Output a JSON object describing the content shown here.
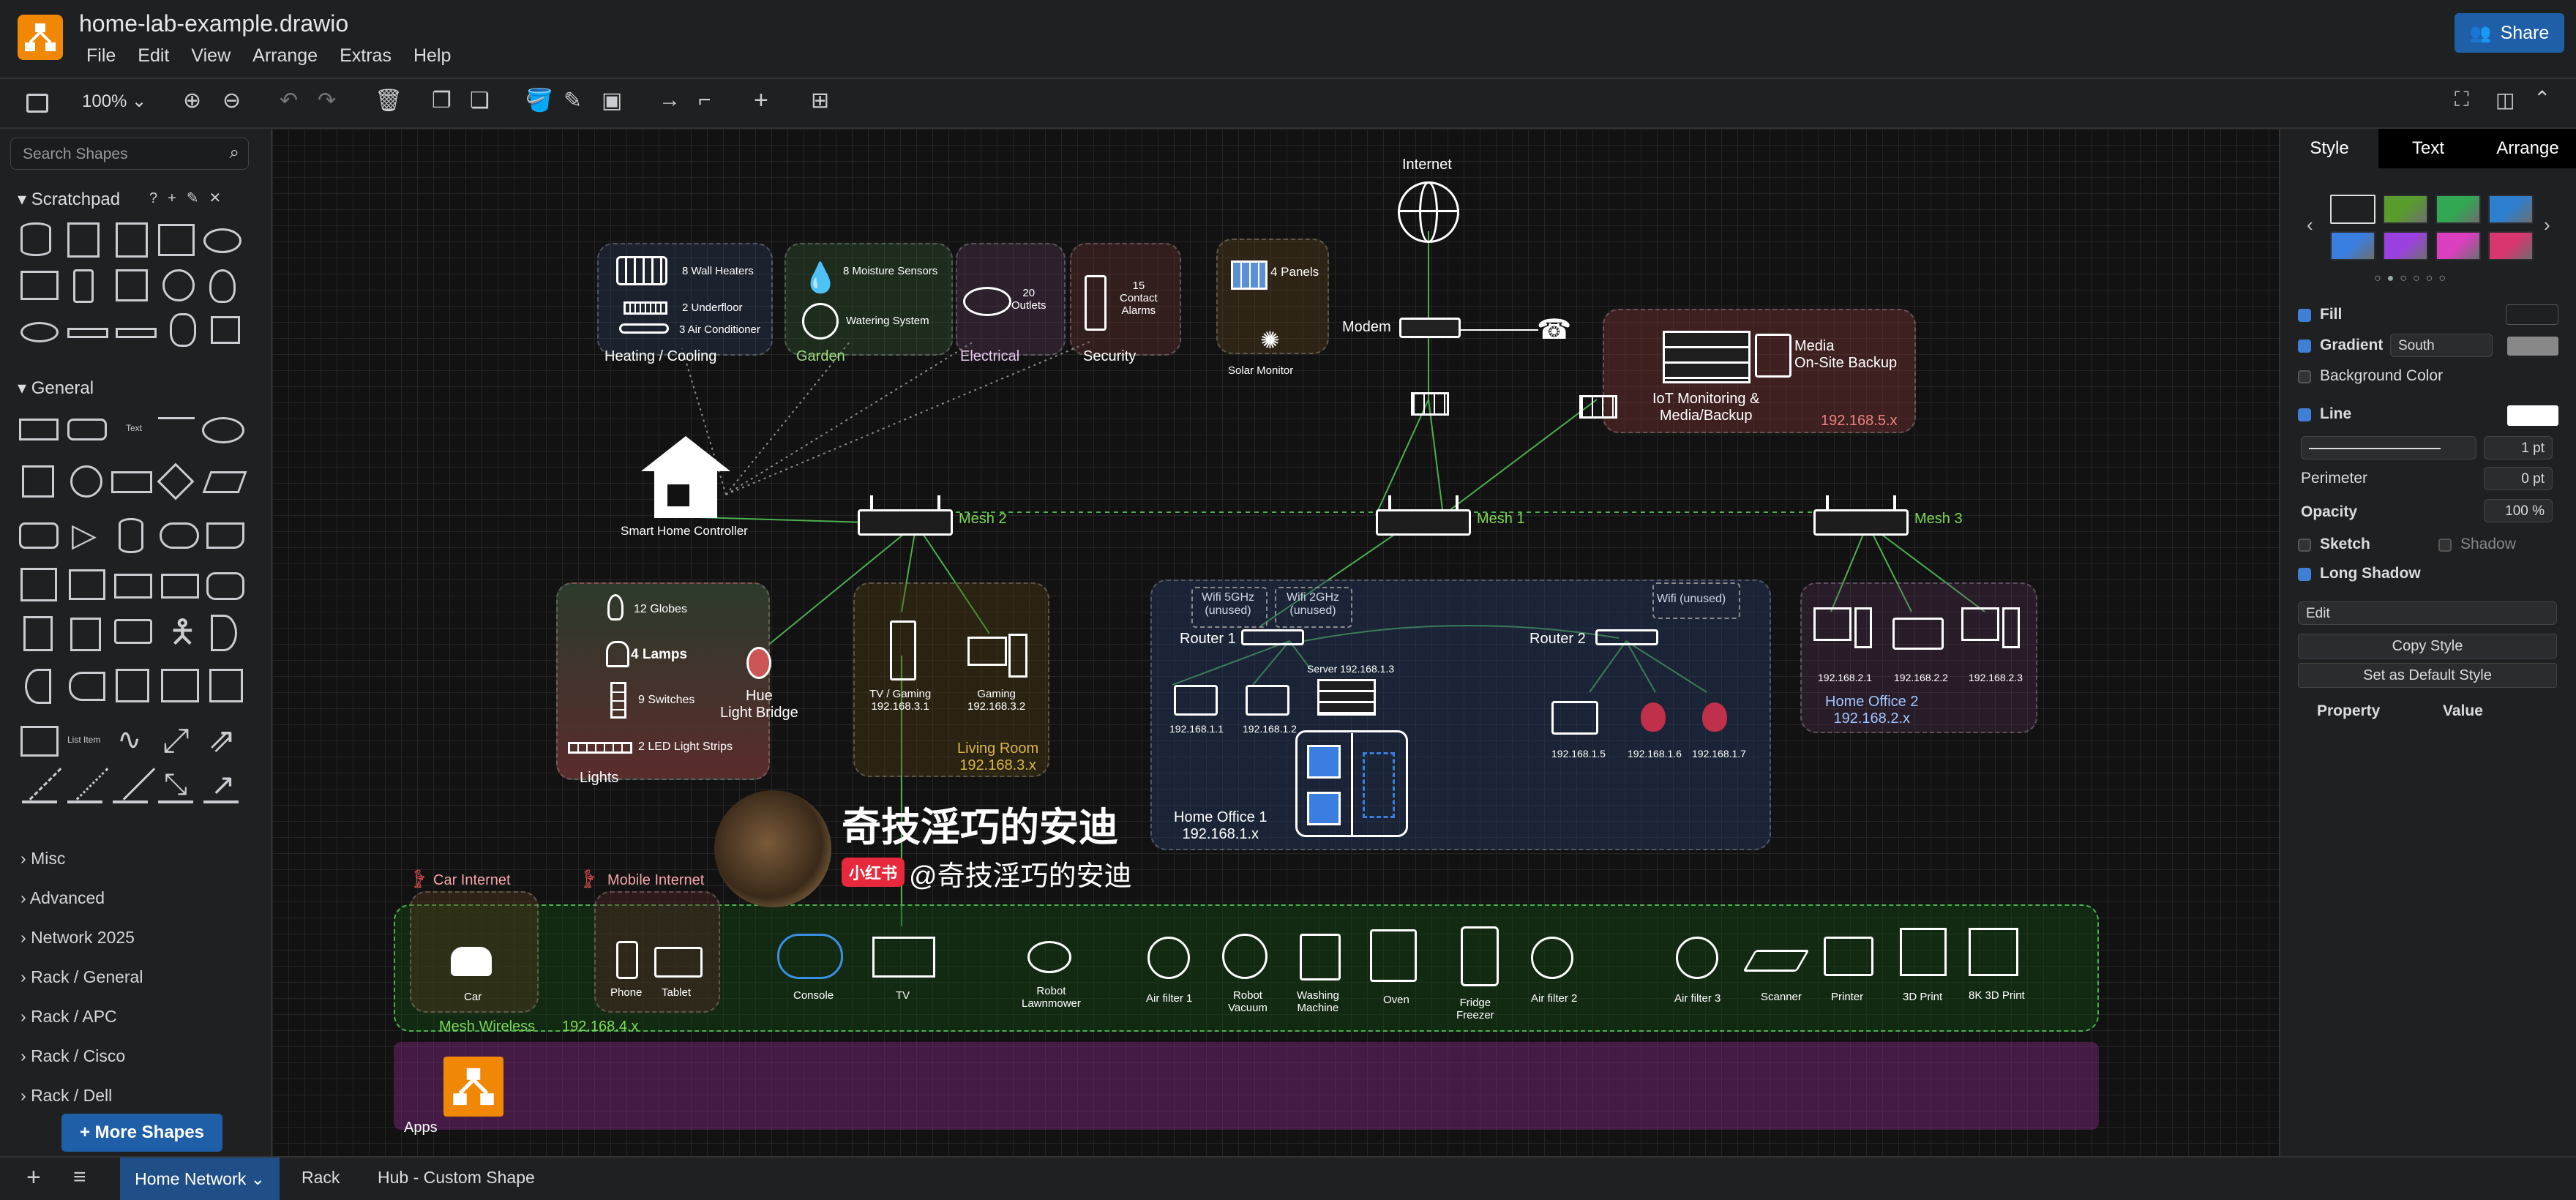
{
  "app": {
    "file_name": "home-lab-example.drawio",
    "menu": [
      "File",
      "Edit",
      "View",
      "Arrange",
      "Extras",
      "Help"
    ],
    "share_label": "Share"
  },
  "toolbar": {
    "zoom": "100%"
  },
  "left_panel": {
    "search_placeholder": "Search Shapes",
    "scratchpad_label": "Scratchpad",
    "general_label": "General",
    "collapsed_sections": [
      "Misc",
      "Advanced",
      "Network 2025",
      "Rack / General",
      "Rack / APC",
      "Rack / Cisco",
      "Rack / Dell"
    ],
    "more_shapes": "+ More Shapes"
  },
  "right_panel": {
    "tabs": [
      "Style",
      "Text",
      "Arrange"
    ],
    "active_tab": "Style",
    "swatch_colors": [
      "#1e2022",
      "#5a9b2e",
      "#32a852",
      "#2f7fcf",
      "#3a7fe0",
      "#9b40e0",
      "#d93fbf",
      "#d9356f"
    ],
    "fill_label": "Fill",
    "gradient_label": "Gradient",
    "gradient_direction": "South",
    "background_color_label": "Background Color",
    "line_label": "Line",
    "line_width": "1 pt",
    "perimeter_label": "Perimeter",
    "perimeter_value": "0 pt",
    "opacity_label": "Opacity",
    "opacity_value": "100 %",
    "sketch_label": "Sketch",
    "shadow_label": "Shadow",
    "long_shadow_label": "Long Shadow",
    "edit_value": "Edit",
    "copy_style": "Copy Style",
    "set_default": "Set as Default Style",
    "property_header": "Property",
    "value_header": "Value"
  },
  "pages": {
    "tabs": [
      "Home Network",
      "Rack",
      "Hub - Custom Shape"
    ],
    "active": "Home Network"
  },
  "diagram": {
    "internet": "Internet",
    "modem": "Modem",
    "solar_panels": "4 Panels",
    "solar_monitor": "Solar Monitor",
    "media_backup": "Media\nOn-Site Backup",
    "iot_monitoring": "IoT Monitoring &\nMedia/Backup",
    "backup_ip": "192.168.5.x",
    "heating_items": [
      "8 Wall Heaters",
      "2 Underfloor",
      "3 Air Conditioner"
    ],
    "heating_label": "Heating / Cooling",
    "garden_items": [
      "8 Moisture Sensors",
      "Watering System"
    ],
    "garden_label": "Garden",
    "electrical_item": "20\nOutlets",
    "electrical_label": "Electrical",
    "security_item": "15\nContact\nAlarms",
    "security_label": "Security",
    "smart_home": "Smart Home Controller",
    "mesh2": "Mesh 2",
    "mesh1": "Mesh 1",
    "mesh3": "Mesh 3",
    "lights_items": [
      "12 Globes",
      "4 Lamps",
      "9 Switches",
      "2 LED Light Strips"
    ],
    "lights_label": "Lights",
    "hue": "Hue\nLight Bridge",
    "tv_gaming": "TV / Gaming\n192.168.3.1",
    "gaming": "Gaming\n192.168.3.2",
    "living_room": "Living Room\n192.168.3.x",
    "wifi5": "Wifi 5GHz\n(unused)",
    "wifi2": "Wifi 2GHz\n(unused)",
    "wifi_unused": "Wifi (unused)",
    "router1": "Router 1",
    "router2": "Router 2",
    "server": "Server 192.168.1.3",
    "ip_1_1": "192.168.1.1",
    "ip_1_2": "192.168.1.2",
    "ip_1_5": "192.168.1.5",
    "ip_1_6": "192.168.1.6",
    "ip_1_7": "192.168.1.7",
    "home_office1": "Home Office 1\n192.168.1.x",
    "ip_2_1": "192.168.2.1",
    "ip_2_2": "192.168.2.2",
    "ip_2_3": "192.168.2.3",
    "home_office2": "Home Office 2\n192.168.2.x",
    "car_internet": "Car Internet",
    "mobile_internet": "Mobile Internet",
    "car": "Car",
    "phone": "Phone",
    "tablet": "Tablet",
    "mesh_wireless": "Mesh Wireless",
    "wireless_ip": "192.168.4.x",
    "devices": [
      "Console",
      "TV",
      "Robot\nLawnmower",
      "Air filter 1",
      "Robot\nVacuum",
      "Washing\nMachine",
      "Oven",
      "Fridge\nFreezer",
      "Air filter 2",
      "Air filter 3",
      "Scanner",
      "Printer",
      "3D Print",
      "8K 3D Print"
    ],
    "apps": "Apps"
  },
  "watermark": {
    "title": "奇技淫巧的安迪",
    "badge": "小红书",
    "handle": "@奇技淫巧的安迪"
  }
}
